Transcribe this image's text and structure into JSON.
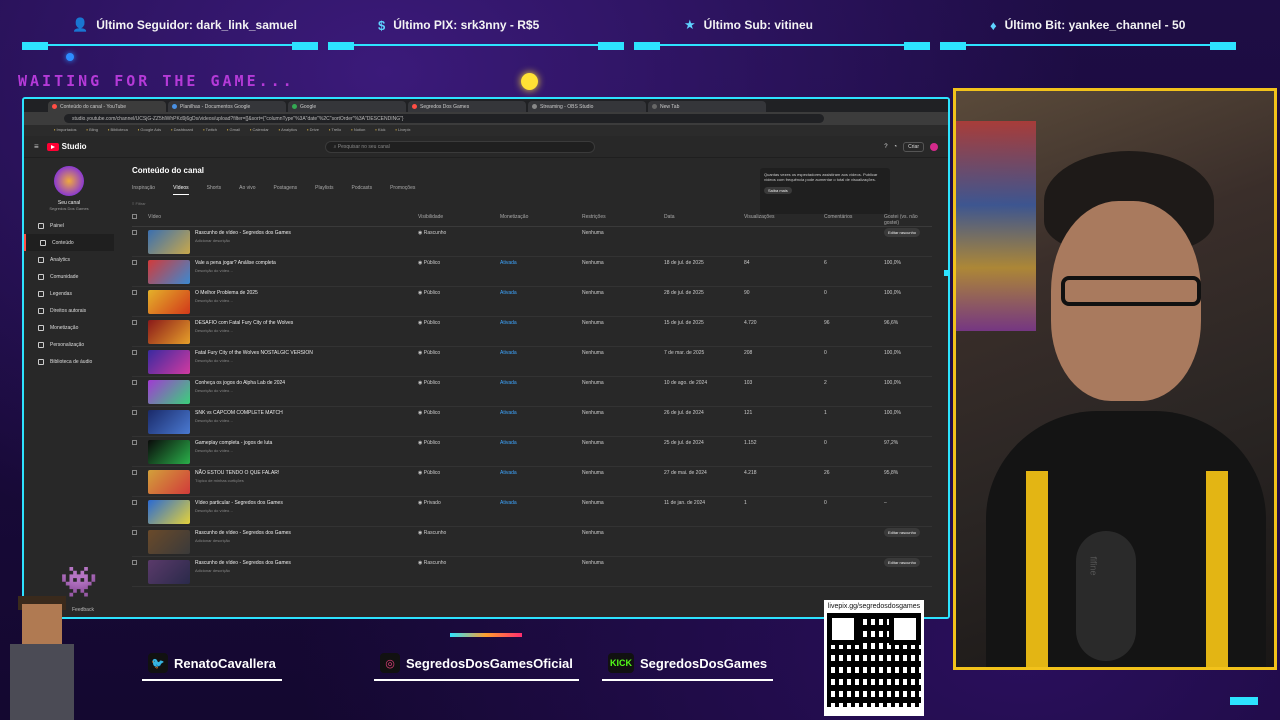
{
  "alerts": [
    {
      "icon": "person-icon",
      "text": "Último Seguidor: dark_link_samuel"
    },
    {
      "icon": "dollar-icon",
      "text": "Último PIX: srk3nny - R$5"
    },
    {
      "icon": "star-icon",
      "text": "Último Sub: vitineu"
    },
    {
      "icon": "diamond-icon",
      "text": "Último Bit: yankee_channel - 50"
    }
  ],
  "waiting_text": "WAITING FOR THE GAME...",
  "browser": {
    "address": "studio.youtube.com/channel/UCSjG-ZZ5hlWhPKd9j6gDs/videos/upload?filter=[]&sort={\"columnType\"%3A\"date\"%2C\"sortOrder\"%3A\"DESCENDING\"}",
    "tabs": [
      "Conteúdo do canal - YouTube",
      "Planilhas - Documentos Google",
      "Google",
      "Segredos Dos Games",
      "Streaming - OBS Studio",
      "New Tab"
    ],
    "bookmarks": [
      "Importados",
      "Bling",
      "Biblioteca",
      "Google Ads",
      "Dashboard",
      "Twitch",
      "Gmail",
      "Calendar",
      "Analytics",
      "Drive",
      "Trello",
      "Notion",
      "Kick",
      "Livepix"
    ]
  },
  "studio": {
    "logo": "Studio",
    "search_placeholder": "Pesquisar no seu canal",
    "create_label": "Criar",
    "channel_name": "Seu canal",
    "channel_sub": "Segredos Dos Games",
    "nav": [
      "Painel",
      "Conteúdo",
      "Analytics",
      "Comunidade",
      "Legendas",
      "Direitos autorais",
      "Monetização",
      "Personalização",
      "Biblioteca de áudio"
    ],
    "title": "Conteúdo do canal",
    "sub_tabs": [
      "Inspiração",
      "Vídeos",
      "Shorts",
      "Ao vivo",
      "Postagens",
      "Playlists",
      "Podcasts",
      "Promoções"
    ],
    "active_sub_tab": "Vídeos",
    "filter_label": "Filtrar",
    "tip_text": "Quantas vezes os espectadores assistiram aos vídeos. Publicar vídeos com frequência pode aumentar o total de visualizações.",
    "tip_button": "Saiba mais",
    "columns": [
      "Vídeo",
      "Visibilidade",
      "Monetização",
      "Restrições",
      "Data",
      "Visualizações",
      "Comentários",
      "Gostei (vs. não gostei)"
    ],
    "feedback": "Feedback",
    "rows": [
      {
        "title": "Rascunho de vídeo - Segredos dos Games",
        "desc": "Adicionar descrição",
        "visibility": "Rascunho",
        "monet": "",
        "restr": "Nenhuma",
        "date": "",
        "views": "",
        "comments": "",
        "likes": "",
        "action": "Editar rascunho",
        "c1": "#3a6fb0",
        "c2": "#c9a84a"
      },
      {
        "title": "Vale a pena jogar? Análise completa",
        "desc": "Descrição do vídeo…",
        "visibility": "Público",
        "monet": "Ativada",
        "restr": "Nenhuma",
        "date": "18 de jul. de 2025",
        "views": "84",
        "comments": "6",
        "likes": "100,0%",
        "action": "",
        "c1": "#d23a3a",
        "c2": "#3a8ad2"
      },
      {
        "title": "O Melhor Problema de 2025",
        "desc": "Descrição do vídeo…",
        "visibility": "Público",
        "monet": "Ativada",
        "restr": "Nenhuma",
        "date": "28 de jul. de 2025",
        "views": "90",
        "comments": "0",
        "likes": "100,0%",
        "action": "",
        "c1": "#e4b12a",
        "c2": "#d2381a"
      },
      {
        "title": "DESAFIO com Fatal Fury City of the Wolves",
        "desc": "Descrição do vídeo…",
        "visibility": "Público",
        "monet": "Ativada",
        "restr": "Nenhuma",
        "date": "15 de jul. de 2025",
        "views": "4.720",
        "comments": "96",
        "likes": "96,6%",
        "action": "",
        "c1": "#8a1a1a",
        "c2": "#e7a02a"
      },
      {
        "title": "Fatal Fury City of the Wolves NOSTALGIC VERSION",
        "desc": "Descrição do vídeo…",
        "visibility": "Público",
        "monet": "Ativada",
        "restr": "Nenhuma",
        "date": "7 de mar. de 2025",
        "views": "208",
        "comments": "0",
        "likes": "100,0%",
        "action": "",
        "c1": "#3a2aa0",
        "c2": "#d23aa0"
      },
      {
        "title": "Conheça os jogos do Alpha Lab de 2024",
        "desc": "Descrição do vídeo…",
        "visibility": "Público",
        "monet": "Ativada",
        "restr": "Nenhuma",
        "date": "10 de ago. de 2024",
        "views": "103",
        "comments": "2",
        "likes": "100,0%",
        "action": "",
        "c1": "#a03ad2",
        "c2": "#3ad27a"
      },
      {
        "title": "SNK vs CAPCOM COMPLETE MATCH",
        "desc": "Descrição do vídeo…",
        "visibility": "Público",
        "monet": "Ativada",
        "restr": "Nenhuma",
        "date": "26 de jul. de 2024",
        "views": "121",
        "comments": "1",
        "likes": "100,0%",
        "action": "",
        "c1": "#1a2a6a",
        "c2": "#4a7ad2"
      },
      {
        "title": "Gameplay completa - jogos de luta",
        "desc": "Descrição do vídeo…",
        "visibility": "Público",
        "monet": "Ativada",
        "restr": "Nenhuma",
        "date": "25 de jul. de 2024",
        "views": "1.152",
        "comments": "0",
        "likes": "97,2%",
        "action": "",
        "c1": "#0a0a0a",
        "c2": "#2ab04a"
      },
      {
        "title": "NÃO ESTOU TENDO O QUE FALAR!",
        "desc": "Tópico de minhas curtições",
        "visibility": "Público",
        "monet": "Ativada",
        "restr": "Nenhuma",
        "date": "27 de mai. de 2024",
        "views": "4.218",
        "comments": "26",
        "likes": "95,8%",
        "action": "",
        "c1": "#d2a03a",
        "c2": "#d23a3a"
      },
      {
        "title": "Vídeo particular - Segredos dos Games",
        "desc": "Descrição do vídeo…",
        "visibility": "Privado",
        "monet": "Ativada",
        "restr": "Nenhuma",
        "date": "11 de jan. de 2024",
        "views": "1",
        "comments": "0",
        "likes": "–",
        "action": "",
        "c1": "#2a6ad2",
        "c2": "#e4d23a"
      },
      {
        "title": "Rascunho de vídeo - Segredos dos Games",
        "desc": "Adicionar descrição",
        "visibility": "Rascunho",
        "monet": "",
        "restr": "Nenhuma",
        "date": "",
        "views": "",
        "comments": "",
        "likes": "",
        "action": "Editar rascunho",
        "c1": "#6a4a2a",
        "c2": "#3a3a3a"
      },
      {
        "title": "Rascunho de vídeo - Segredos dos Games",
        "desc": "Adicionar descrição",
        "visibility": "Rascunho",
        "monet": "",
        "restr": "Nenhuma",
        "date": "",
        "views": "",
        "comments": "",
        "likes": "",
        "action": "Editar rascunho",
        "c1": "#5a3a6a",
        "c2": "#2a2a4a"
      }
    ]
  },
  "socials": [
    {
      "icon": "twitter-icon",
      "glyph": "🐦",
      "handle": "RenatoCavallera"
    },
    {
      "icon": "instagram-icon",
      "glyph": "◎",
      "handle": "SegredosDosGamesOficial"
    },
    {
      "icon": "kick-icon",
      "glyph": "KICK",
      "handle": "SegredosDosGames"
    }
  ],
  "qr_url": "livepix.gg/segredosdosgames",
  "webcam_mic_brand": "fifine",
  "colors": {
    "accent": "#2de3ff",
    "cam_border": "#f2c21b",
    "studio_red": "#ff0033"
  }
}
